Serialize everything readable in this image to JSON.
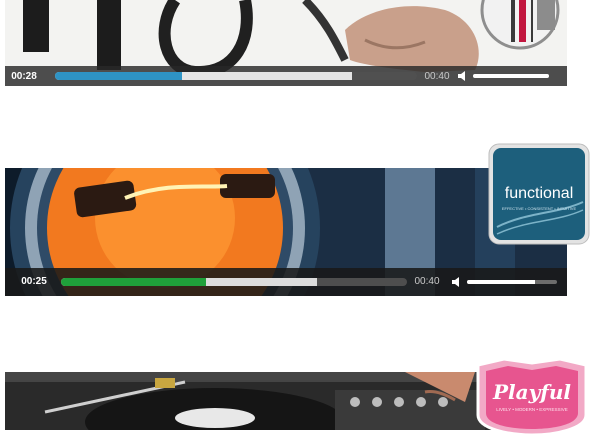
{
  "players": [
    {
      "current_time": "00:28",
      "duration": "00:40",
      "progress_fraction": 0.35,
      "buffered_fraction": 0.82,
      "volume_fraction": 1.0,
      "accent_color": "#2e93c4",
      "badge": {
        "style": "monochrome red-stripe badge"
      }
    },
    {
      "current_time": "00:25",
      "duration": "00:40",
      "progress_fraction": 0.42,
      "buffered_fraction": 0.74,
      "volume_fraction": 0.75,
      "accent_color": "#1fa03a",
      "badge": {
        "word": "functional",
        "tagline": "EFFECTIVE • CONSISTENT • INTUITIVE"
      }
    },
    {
      "badge": {
        "word": "Playful",
        "tagline": "LIVELY • MODERN • EXPRESSIVE"
      }
    }
  ],
  "icons": {
    "volume": "speaker-icon"
  }
}
